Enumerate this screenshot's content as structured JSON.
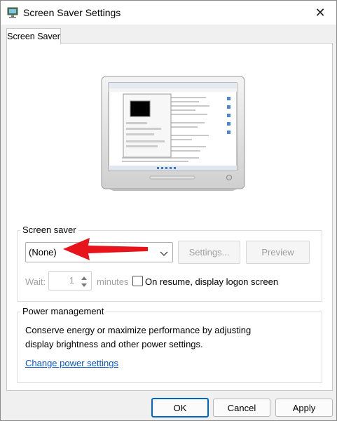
{
  "window": {
    "title": "Screen Saver Settings",
    "close_symbol": "✕"
  },
  "tab": {
    "label": "Screen Saver"
  },
  "screen_saver": {
    "group_label": "Screen saver",
    "selected": "(None)",
    "settings_label": "Settings...",
    "preview_label": "Preview",
    "wait_label": "Wait:",
    "wait_value": "1",
    "minutes_label": "minutes",
    "resume_label": "On resume, display logon screen",
    "resume_checked": false
  },
  "power": {
    "group_label": "Power management",
    "description_line1": "Conserve energy or maximize performance by adjusting",
    "description_line2": "display brightness and other power settings.",
    "link_text": "Change power settings"
  },
  "footer": {
    "ok_label": "OK",
    "cancel_label": "Cancel",
    "apply_label": "Apply"
  },
  "colors": {
    "accent": "#0067c0",
    "arrow": "#e8141b",
    "link": "#0a58ca"
  }
}
